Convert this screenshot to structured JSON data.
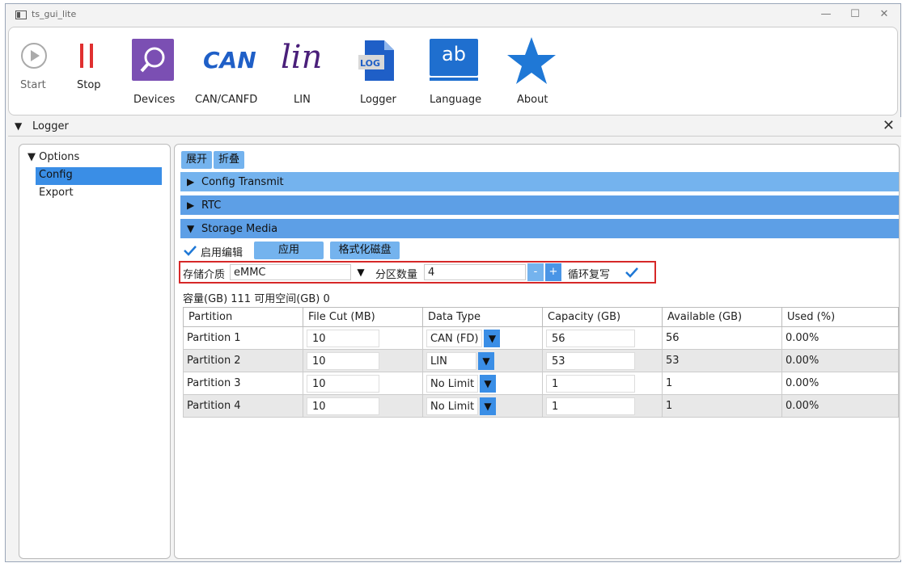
{
  "window": {
    "title": "ts_gui_lite",
    "minimize": "—",
    "maximize": "☐",
    "close": "✕"
  },
  "toolbar": {
    "start": "Start",
    "stop": "Stop",
    "devices": "Devices",
    "can": "CAN/CANFD",
    "can_logo": "CAN",
    "lin": "LIN",
    "lin_logo": "lin",
    "logger": "Logger",
    "logger_logo": "LOG",
    "language": "Language",
    "language_logo": "ab",
    "about": "About"
  },
  "panel": {
    "title": "Logger",
    "close": "✕"
  },
  "tree": {
    "root": "Options",
    "items": [
      "Config",
      "Export"
    ]
  },
  "content": {
    "expand_btn": "展开",
    "collapse_btn": "折叠",
    "sections": [
      "Config Transmit",
      "RTC",
      "Storage Media"
    ],
    "enable_edit": "启用编辑",
    "apply_btn": "应用",
    "format_btn": "格式化磁盘",
    "storage_label": "存储介质",
    "storage_value": "eMMC",
    "partitions_label": "分区数量",
    "partitions_value": "4",
    "minus": "-",
    "plus": "+",
    "loop_label": "循环复写",
    "capacity_line": "容量(GB) 111 可用空间(GB) 0"
  },
  "table": {
    "headers": [
      "Partition",
      "File Cut (MB)",
      "Data Type",
      "Capacity (GB)",
      "Available (GB)",
      "Used (%)"
    ],
    "rows": [
      [
        "Partition 1",
        "10",
        "CAN (FD)",
        "56",
        "56",
        "0.00%"
      ],
      [
        "Partition 2",
        "10",
        "LIN",
        "53",
        "53",
        "0.00%"
      ],
      [
        "Partition 3",
        "10",
        "No Limit",
        "1",
        "1",
        "0.00%"
      ],
      [
        "Partition 4",
        "10",
        "No Limit",
        "1",
        "1",
        "0.00%"
      ]
    ]
  },
  "colors": {
    "accent": "#3a8ee6",
    "section_blue": "#74b3ee",
    "red_highlight": "#d62828",
    "tree_selected": "#3a8ee6"
  }
}
